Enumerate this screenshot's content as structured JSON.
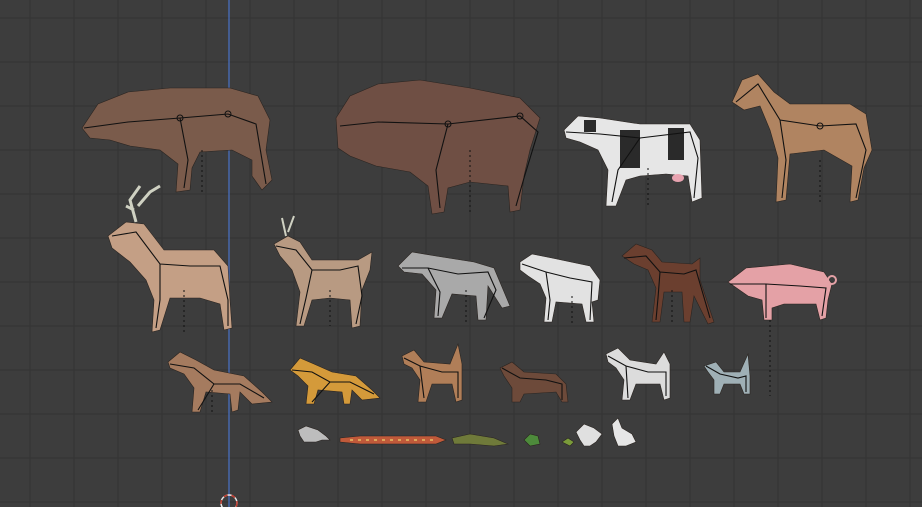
{
  "viewport": {
    "background_color": "#3d3d3d",
    "grid_color": "#333333",
    "axis_color": "#4a73c9"
  },
  "animals": [
    {
      "name": "bear",
      "color": "#7a5b4b"
    },
    {
      "name": "bison",
      "color": "#6f4f44"
    },
    {
      "name": "cow",
      "color": "#e6e6e6"
    },
    {
      "name": "horse",
      "color": "#b08461"
    },
    {
      "name": "stag",
      "color": "#c49f85"
    },
    {
      "name": "deer",
      "color": "#b89a82"
    },
    {
      "name": "wolf",
      "color": "#a9a9a9"
    },
    {
      "name": "sheep",
      "color": "#e2e2e2"
    },
    {
      "name": "doberman",
      "color": "#6b3f2f"
    },
    {
      "name": "pig",
      "color": "#e4a1a6"
    },
    {
      "name": "fox-gray",
      "color": "#a57b5f"
    },
    {
      "name": "fox-orange",
      "color": "#d49a3a"
    },
    {
      "name": "dog",
      "color": "#b07e58"
    },
    {
      "name": "dachshund",
      "color": "#6d4a3a"
    },
    {
      "name": "husky",
      "color": "#dcdcdc"
    },
    {
      "name": "cat",
      "color": "#9fb0b6"
    },
    {
      "name": "rat",
      "color": "#bdbdbd"
    },
    {
      "name": "snake",
      "color": "#c05a3a"
    },
    {
      "name": "lizard",
      "color": "#6f7a3a"
    },
    {
      "name": "frog",
      "color": "#4d8a3b"
    },
    {
      "name": "chick",
      "color": "#7a9b3a"
    },
    {
      "name": "chicken",
      "color": "#e0e0e0"
    },
    {
      "name": "duck",
      "color": "#e6e6e6"
    }
  ]
}
